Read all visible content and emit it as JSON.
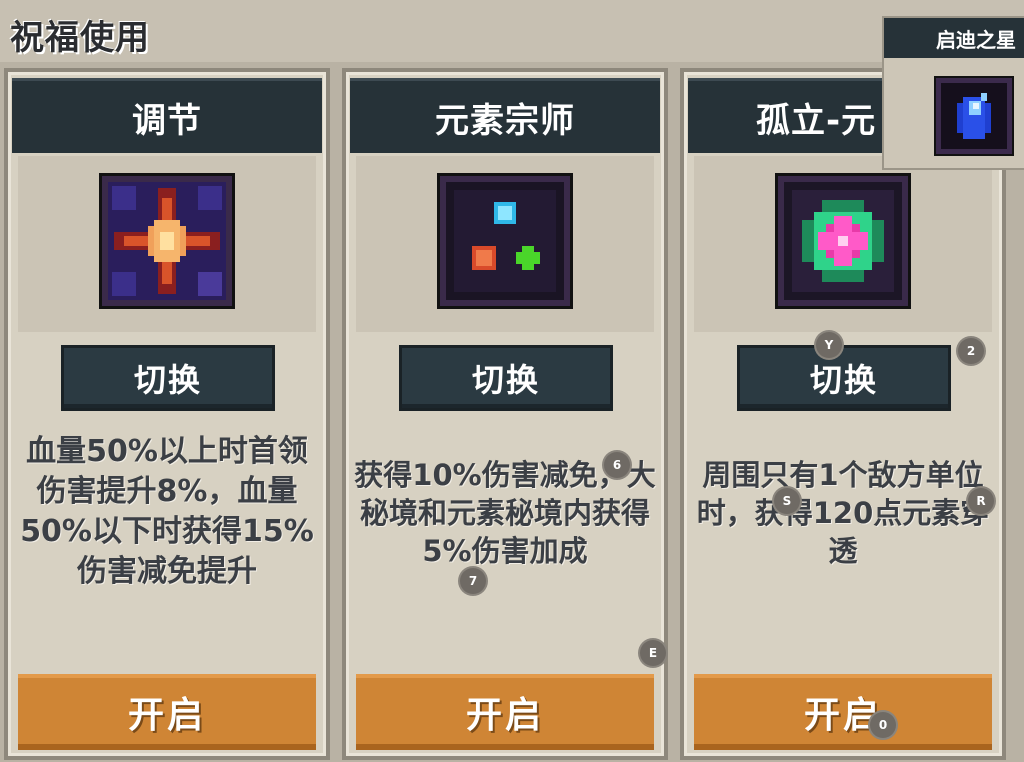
{
  "page_title": "祝福使用",
  "cards": [
    {
      "title": "调节",
      "icon": "blessing-regulate-icon",
      "switch_label": "切换",
      "description": "血量50%以上时首领伤害提升8%，血量50%以下时获得15%伤害减免提升",
      "open_label": "开启"
    },
    {
      "title": "元素宗师",
      "icon": "blessing-element-master-icon",
      "switch_label": "切换",
      "description": "获得10%伤害减免，大秘境和元素秘境内获得5%伤害加成",
      "open_label": "开启"
    },
    {
      "title": "孤立-元",
      "icon": "blessing-isolation-element-icon",
      "switch_label": "切换",
      "description": "周围只有1个敌方单位时，获得120点元素穿透",
      "open_label": "开启"
    }
  ],
  "popup": {
    "title": "启迪之星",
    "icon": "star-of-enlightenment-icon"
  },
  "key_hints": [
    "Y",
    "2",
    "6",
    "S",
    "R",
    "7",
    "E",
    "0"
  ],
  "colors": {
    "header_bg": "#263238",
    "button_dark": "#2b3a42",
    "button_orange": "#cf8535",
    "panel_bg": "#d7d1c2"
  }
}
